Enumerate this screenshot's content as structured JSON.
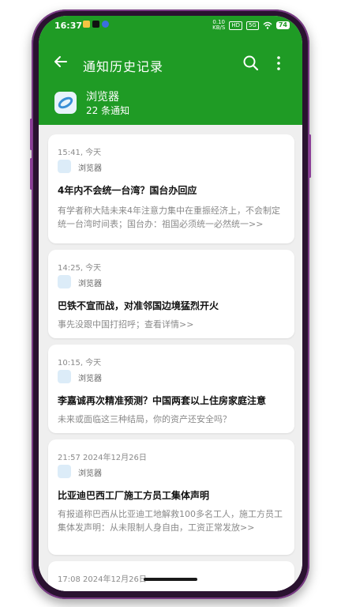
{
  "status_bar": {
    "time": "16:37",
    "net_speed_top": "0.10",
    "net_speed_bottom": "KB/S",
    "hd": "HD",
    "signal": "5G",
    "battery": "74"
  },
  "toolbar": {
    "back_icon": "arrow-left-icon",
    "title": "通知历史记录",
    "search_icon": "search-icon",
    "more_icon": "more-vert-icon"
  },
  "app": {
    "name": "浏览器",
    "count": "22 条通知",
    "icon": "browser-app-icon"
  },
  "notifications": [
    {
      "time": "15:41, 今天",
      "source": "浏览器",
      "title": "4年内不会统一台湾？国台办回应",
      "body": "有学者称大陆未来4年注意力集中在重振经济上，不会制定统一台湾时间表；国台办：祖国必须统一必然统一>>"
    },
    {
      "time": "14:25, 今天",
      "source": "浏览器",
      "title": "巴铁不宣而战，对准邻国边境猛烈开火",
      "body": "事先没跟中国打招呼；查看详情>>"
    },
    {
      "time": "10:15, 今天",
      "source": "浏览器",
      "title": "李嘉诚再次精准预测？中国两套以上住房家庭注意",
      "body": "未来或面临这三种结局，你的资产还安全吗？"
    },
    {
      "time": "21:57 2024年12月26日",
      "source": "浏览器",
      "title": "比亚迪巴西工厂施工方员工集体声明",
      "body": "有报道称巴西从比亚迪工地解救100多名工人，施工方员工集体发声明：从未限制人身自由，工资正常发放>>"
    },
    {
      "time": "17:08 2024年12月26日",
      "source": "",
      "title": "",
      "body": ""
    }
  ],
  "colors": {
    "header": "#1f9b25",
    "background": "#efefef",
    "card": "#ffffff"
  }
}
